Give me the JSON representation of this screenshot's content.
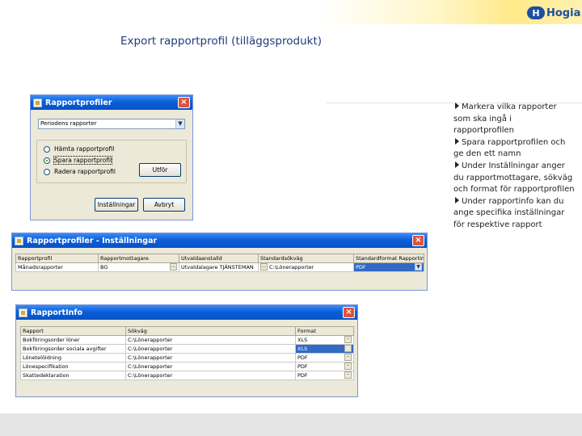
{
  "slide": {
    "title": "Export rapportprofil (tilläggsprodukt)",
    "logo_mark": "H",
    "logo_text": "Hogia",
    "bullets": [
      "Markera vilka rapporter som ska ingå i rapportprofilen",
      "Spara rapportprofilen och ge den ett namn",
      "Under Inställningar anger du rapportmottagare, sökväg och format för rapportprofilen",
      "Under rapportinfo kan du ange specifika inställningar för respektive rapport"
    ]
  },
  "dialog_profiles": {
    "title": "Rapportprofiler",
    "close": "×",
    "profile_select": "Periodens rapporter",
    "dropdown_arrow": "▼",
    "radios": [
      "Hämta rapportprofil",
      "Spara rapportprofil",
      "Radera rapportprofil"
    ],
    "selected_radio": 1,
    "ok_button": "Utför",
    "settings_button": "Inställningar",
    "cancel_button": "Avbryt"
  },
  "dialog_settings": {
    "title": "Rapportprofiler - Inställningar",
    "close": "×",
    "columns": [
      "Rapportprofil",
      "Rapportmottagare",
      "Utvaldaanstalld",
      "Standardsökväg",
      "Standardformat Rapportinfo"
    ],
    "row": [
      "Månadsrapporter",
      "BG",
      "Utvaldalagare TJÄNSTEMAN",
      "C:\\Lönerapporter",
      "PDF"
    ]
  },
  "dialog_report_info": {
    "title": "RapportInfo",
    "close": "×",
    "columns": [
      "Rapport",
      "Sökväg",
      "Format"
    ],
    "rows": [
      [
        "Bokföringsorder löner",
        "C:\\Lönerapporter",
        "XLS"
      ],
      [
        "Bokföringsorder sociala avgifter",
        "C:\\Lönerapporter",
        "XLS"
      ],
      [
        "Lönetelöidning",
        "C:\\Lönerapporter",
        "PDF"
      ],
      [
        "Lönespecifikation",
        "C:\\Lönerapporter",
        "PDF"
      ],
      [
        "Skattedeklaration",
        "C:\\Lönerapporter",
        "PDF"
      ]
    ],
    "selected_row": 1
  },
  "colors": {
    "title_blue": "#1f3a7a",
    "titlebar_blue": "#0a5fd8",
    "selection_blue": "#316ac5",
    "close_red": "#e0533a"
  }
}
